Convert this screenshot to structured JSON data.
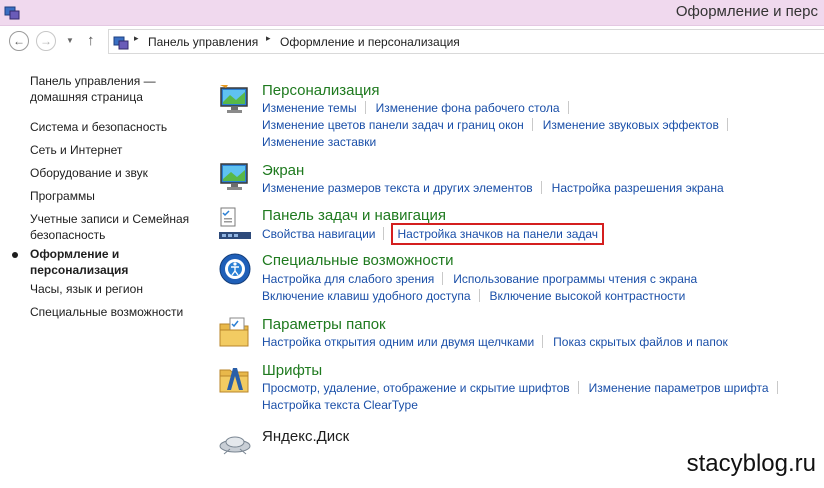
{
  "window": {
    "title": "Оформление и перс"
  },
  "nav": {
    "back_glyph": "←",
    "forward_glyph": "→",
    "recent_glyph": "▼",
    "up_glyph": "↑"
  },
  "address": {
    "separator": "▸",
    "crumbs": [
      "Панель управления",
      "Оформление и персонализация"
    ]
  },
  "left_pane": {
    "items": [
      {
        "label": "Панель управления —"
      },
      {
        "label": "домашняя страница"
      },
      {
        "label": "Система и безопасность"
      },
      {
        "label": "Сеть и Интернет"
      },
      {
        "label": "Оборудование и звук"
      },
      {
        "label": "Программы"
      },
      {
        "label": "Учетные записи и Семейная"
      },
      {
        "label": "безопасность"
      },
      {
        "label": "Оформление и"
      },
      {
        "label": "персонализация"
      },
      {
        "label": "Часы, язык и регион"
      },
      {
        "label": "Специальные возможности"
      }
    ]
  },
  "categories": [
    {
      "title": "Персонализация",
      "icon": "personalization-icon",
      "rows": [
        [
          "Изменение темы",
          "Изменение фона рабочего стола"
        ],
        [
          "Изменение цветов панели задач и границ окон",
          "Изменение звуковых эффектов"
        ],
        [
          "Изменение заставки"
        ]
      ]
    },
    {
      "title": "Экран",
      "icon": "display-icon",
      "rows": [
        [
          "Изменение размеров текста и других элементов",
          "Настройка разрешения экрана"
        ]
      ]
    },
    {
      "title": "Панель задач и навигация",
      "icon": "taskbar-icon",
      "rows": [
        [
          "Свойства навигации",
          "Настройка значков на панели задач"
        ]
      ]
    },
    {
      "title": "Специальные возможности",
      "icon": "ease-of-access-icon",
      "rows": [
        [
          "Настройка для слабого зрения",
          "Использование программы чтения с экрана"
        ],
        [
          "Включение клавиш удобного доступа",
          "Включение высокой контрастности"
        ]
      ]
    },
    {
      "title": "Параметры папок",
      "icon": "folder-options-icon",
      "rows": [
        [
          "Настройка открытия одним или двумя щелчками",
          "Показ скрытых файлов и папок"
        ]
      ]
    },
    {
      "title": "Шрифты",
      "icon": "fonts-icon",
      "rows": [
        [
          "Просмотр, удаление, отображение и скрытие шрифтов",
          "Изменение параметров шрифта"
        ],
        [
          "Настройка текста ClearType"
        ]
      ]
    },
    {
      "title": "Яндекс.Диск",
      "icon": "yandex-disk-icon",
      "rows": []
    }
  ],
  "watermark": "stacyblog.ru",
  "colors": {
    "category_title": "#1f7a1f",
    "task_link": "#1a4fa8",
    "highlight_box": "#d41f1f",
    "titlebar": "#f0d9ee"
  }
}
